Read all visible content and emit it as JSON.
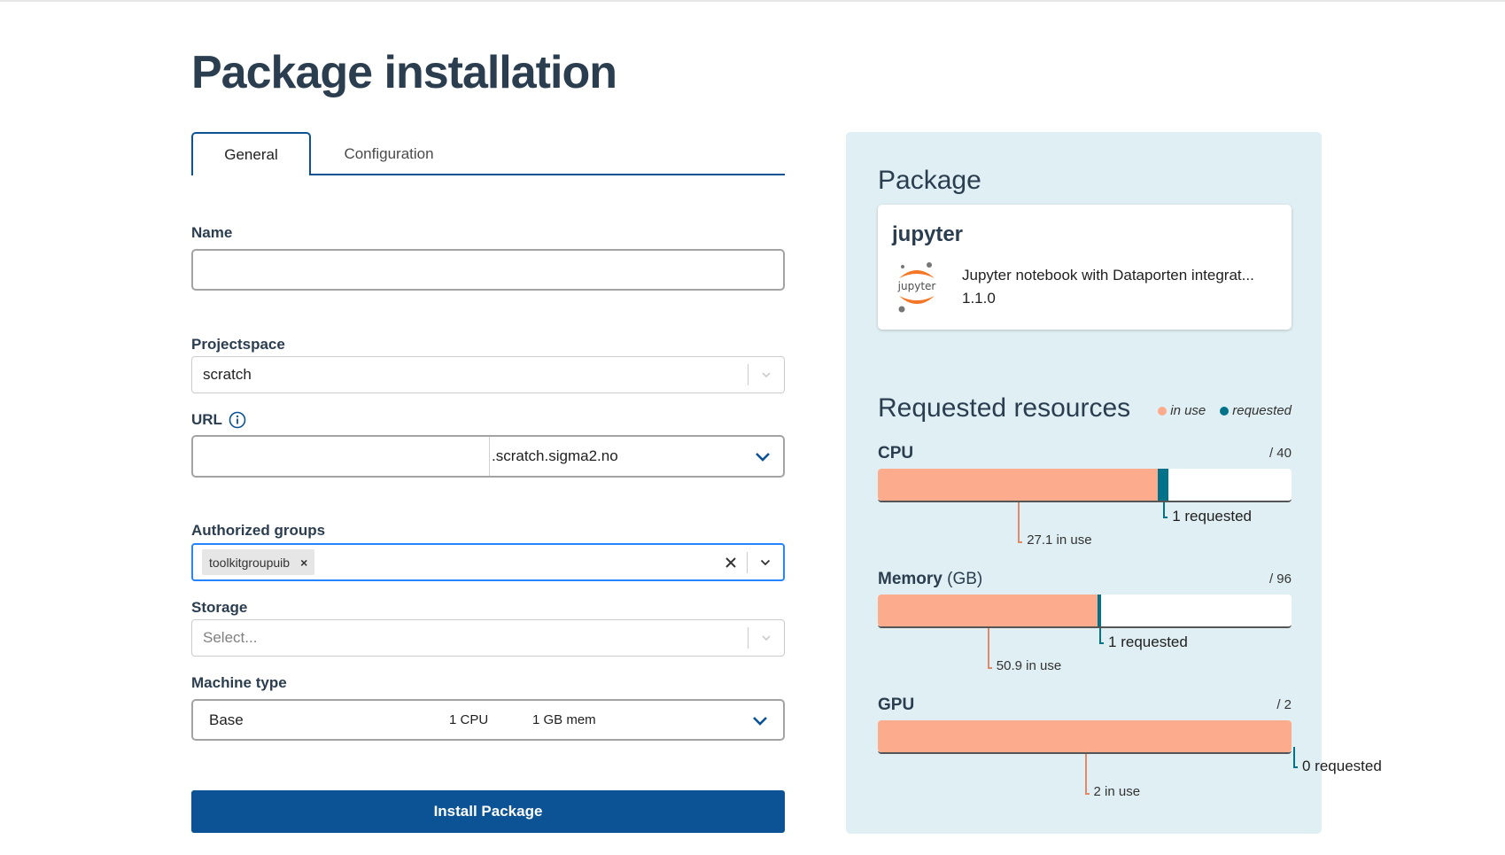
{
  "page": {
    "title": "Package installation"
  },
  "tabs": [
    {
      "label": "General",
      "active": true
    },
    {
      "label": "Configuration",
      "active": false
    }
  ],
  "form": {
    "name": {
      "label": "Name",
      "value": "",
      "placeholder": ""
    },
    "projectspace": {
      "label": "Projectspace",
      "value": "scratch"
    },
    "url": {
      "label": "URL",
      "value": "",
      "suffix": ".scratch.sigma2.no"
    },
    "authorized_groups": {
      "label": "Authorized groups",
      "chips": [
        "toolkitgroupuib"
      ],
      "remove_glyph": "×",
      "clear_glyph": "✕"
    },
    "storage": {
      "label": "Storage",
      "placeholder": "Select..."
    },
    "machine_type": {
      "label": "Machine type",
      "name": "Base",
      "cpu": "1 CPU",
      "mem": "1 GB mem"
    },
    "submit_label": "Install Package"
  },
  "package_panel": {
    "title": "Package",
    "package": {
      "name": "jupyter",
      "logo_text": "jupyter",
      "description": "Jupyter notebook with Dataporten integrat...",
      "version": "1.1.0"
    }
  },
  "resources": {
    "title": "Requested resources",
    "legend": [
      {
        "label": "in use",
        "color": "#fdab8d"
      },
      {
        "label": "requested",
        "color": "#00728a"
      }
    ],
    "colors": {
      "in_use": "#fdab8d",
      "requested": "#00728a"
    },
    "items": [
      {
        "name": "CPU",
        "unit": "",
        "max": 40,
        "max_label": "/ 40",
        "in_use": 27.1,
        "requested": 1,
        "in_use_label": "27.1 in use",
        "requested_label": "1 requested"
      },
      {
        "name": "Memory",
        "unit": "(GB)",
        "max": 96,
        "max_label": "/ 96",
        "in_use": 50.9,
        "requested": 1,
        "in_use_label": "50.9 in use",
        "requested_label": "1 requested"
      },
      {
        "name": "GPU",
        "unit": "",
        "max": 2,
        "max_label": "/ 2",
        "in_use": 2,
        "requested": 0,
        "in_use_label": "2 in use",
        "requested_label": "0 requested"
      }
    ]
  }
}
